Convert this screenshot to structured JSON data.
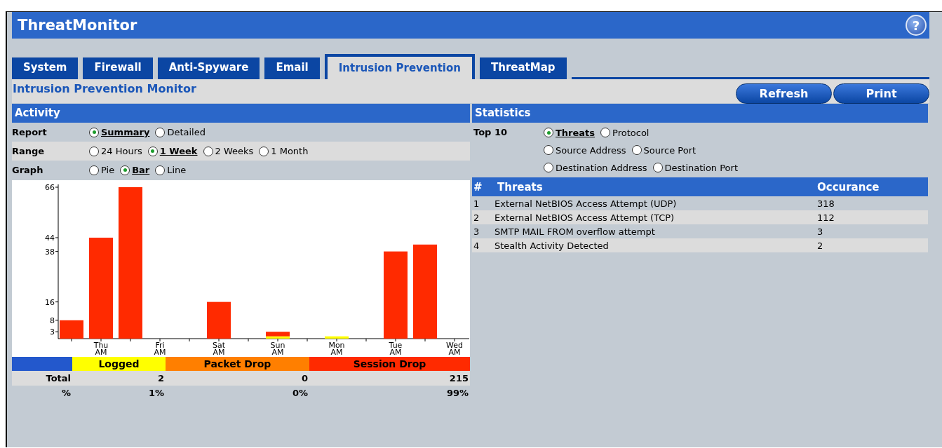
{
  "window": {
    "title": "ThreatMonitor",
    "help": "?"
  },
  "tabs": [
    {
      "label": "System",
      "selected": false
    },
    {
      "label": "Firewall",
      "selected": false
    },
    {
      "label": "Anti-Spyware",
      "selected": false
    },
    {
      "label": "Email",
      "selected": false
    },
    {
      "label": "Intrusion Prevention",
      "selected": true
    },
    {
      "label": "ThreatMap",
      "selected": false
    }
  ],
  "page_title": "Intrusion Prevention Monitor",
  "buttons": [
    "Refresh",
    "Print"
  ],
  "activity": {
    "title": "Activity",
    "rows": [
      {
        "label": "Report",
        "options": [
          [
            {
              "label": "Summary",
              "selected": true
            },
            {
              "label": "Detailed",
              "selected": false
            }
          ]
        ]
      },
      {
        "label": "Range",
        "options": [
          [
            {
              "label": "24 Hours",
              "selected": false
            },
            {
              "label": "1 Week",
              "selected": true
            },
            {
              "label": "2 Weeks",
              "selected": false
            },
            {
              "label": "1 Month",
              "selected": false
            }
          ]
        ]
      },
      {
        "label": "Graph",
        "options": [
          [
            {
              "label": "Pie",
              "selected": false
            },
            {
              "label": "Bar",
              "selected": true
            },
            {
              "label": "Line",
              "selected": false
            }
          ]
        ]
      }
    ],
    "chart_data": {
      "type": "bar",
      "stacked": true,
      "ylim": [
        0,
        66
      ],
      "yticks": [
        3,
        8,
        16,
        38,
        44,
        66
      ],
      "categories": [
        null,
        "Thu AM",
        null,
        "Fri AM",
        null,
        "Sat AM",
        null,
        "Sun AM",
        null,
        "Mon AM",
        null,
        "Tue AM",
        null,
        "Wed AM"
      ],
      "series": [
        {
          "name": "Logged",
          "color": "#ffff00",
          "values": [
            0,
            0,
            0,
            0,
            0,
            0,
            0,
            1,
            0,
            1,
            0,
            0,
            0,
            0
          ]
        },
        {
          "name": "Packet Drop",
          "color": "#ff7f00",
          "values": [
            0,
            0,
            0,
            0,
            0,
            0,
            0,
            0,
            0,
            0,
            0,
            0,
            0,
            0
          ]
        },
        {
          "name": "Session Drop",
          "color": "#ff2a00",
          "values": [
            8,
            44,
            66,
            0,
            0,
            16,
            0,
            2,
            0,
            0,
            0,
            38,
            41,
            0
          ]
        }
      ]
    },
    "totals": [
      {
        "label": "Total",
        "values": [
          "2",
          "0",
          "215"
        ]
      },
      {
        "label": "%",
        "values": [
          "1%",
          "0%",
          "99%"
        ]
      }
    ]
  },
  "statistics": {
    "title": "Statistics",
    "label": "Top 10",
    "options": [
      [
        {
          "label": "Threats",
          "selected": true
        },
        {
          "label": "Protocol",
          "selected": false
        }
      ],
      [
        {
          "label": "Source Address",
          "selected": false
        },
        {
          "label": "Source Port",
          "selected": false
        }
      ],
      [
        {
          "label": "Destination Address",
          "selected": false
        },
        {
          "label": "Destination Port",
          "selected": false
        }
      ]
    ],
    "table": {
      "columns": [
        "#",
        "Threats",
        "Occurance"
      ],
      "rows": [
        [
          "1",
          "External NetBIOS Access Attempt (UDP)",
          "318"
        ],
        [
          "2",
          "External NetBIOS Access Attempt (TCP)",
          "112"
        ],
        [
          "3",
          "SMTP MAIL FROM overflow attempt",
          "3"
        ],
        [
          "4",
          "Stealth Activity Detected",
          "2"
        ]
      ]
    }
  }
}
